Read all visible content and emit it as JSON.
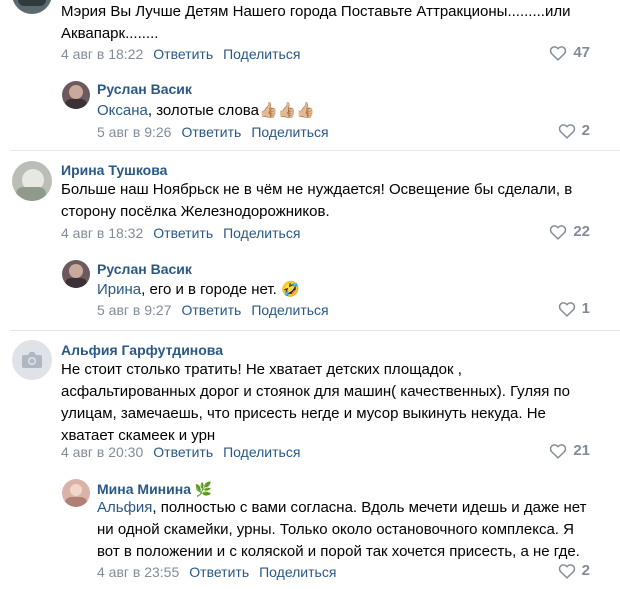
{
  "comments": [
    {
      "text": "Мэрия Вы Лучше Детям Нашего города Поставьте Аттракционы.........или Аквапарк........",
      "date": "4 авг в 18:22",
      "reply": "Ответить",
      "share": "Поделиться",
      "likes": "47"
    },
    {
      "author": "Руслан Васик",
      "reply_to": "Оксана",
      "text": ", золотые слова",
      "emoji": "👍🏼👍🏼👍🏼",
      "date": "5 авг в 9:26",
      "reply": "Ответить",
      "share": "Поделиться",
      "likes": "2"
    },
    {
      "author": "Ирина Тушкова",
      "text": "Больше наш Ноябрьск не в чём не нуждается! Освещение бы сделали, в сторону посёлка Железнодорожников.",
      "date": "4 авг в 18:32",
      "reply": "Ответить",
      "share": "Поделиться",
      "likes": "22"
    },
    {
      "author": "Руслан Васик",
      "reply_to": "Ирина",
      "text": ", его и в городе нет.",
      "emoji": "🤣",
      "date": "5 авг в 9:27",
      "reply": "Ответить",
      "share": "Поделиться",
      "likes": "1"
    },
    {
      "author": "Альфия Гарфутдинова",
      "text": "Не стоит столько тратить! Не хватает детских площадок , асфальтированных дорог и стоянок для машин( качественных). Гуляя по улицам, замечаешь, что присесть негде и мусор выкинуть некуда. Не хватает скамеек и урн",
      "date": "4 авг в 20:30",
      "reply": "Ответить",
      "share": "Поделиться",
      "likes": "21"
    },
    {
      "author": "Мина Минина",
      "author_badge": "🌿",
      "reply_to": "Альфия",
      "text": ", полностью с вами согласна. Вдоль мечети идешь и даже нет ни одной скамейки, урны. Только около остановочного комплекса. Я вот в положении и с коляской и порой так хочется присесть, а не где.",
      "date": "4 авг в 23:55",
      "reply": "Ответить",
      "share": "Поделиться",
      "likes": "2"
    }
  ],
  "icons": {
    "like": "heart-outline-icon",
    "no_photo": "camera-icon"
  },
  "colors": {
    "link": "#2a5885",
    "meta": "#818c99",
    "divider": "#e7e8ec"
  }
}
